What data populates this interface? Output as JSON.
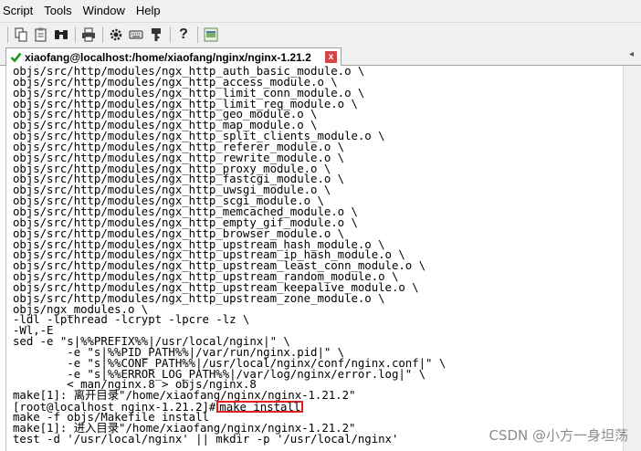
{
  "menubar": {
    "items": [
      "Script",
      "Tools",
      "Window",
      "Help"
    ]
  },
  "toolbar": {
    "icons": [
      "copy-icon",
      "paste-icon",
      "find-icon",
      "print-icon",
      "settings-icon",
      "keyboard-icon",
      "key-icon",
      "help-icon",
      "sftp-icon"
    ]
  },
  "tab": {
    "title": "xiaofang@localhost:/home/xiaofang/nginx/nginx-1.21.2",
    "close_label": "x",
    "scroll_arrow": "◂",
    "status_color": "#1a9a1a"
  },
  "terminal": {
    "lines": [
      "objs/src/http/modules/ngx_http_auth_basic_module.o \\",
      "objs/src/http/modules/ngx_http_access_module.o \\",
      "objs/src/http/modules/ngx_http_limit_conn_module.o \\",
      "objs/src/http/modules/ngx_http_limit_req_module.o \\",
      "objs/src/http/modules/ngx_http_geo_module.o \\",
      "objs/src/http/modules/ngx_http_map_module.o \\",
      "objs/src/http/modules/ngx_http_split_clients_module.o \\",
      "objs/src/http/modules/ngx_http_referer_module.o \\",
      "objs/src/http/modules/ngx_http_rewrite_module.o \\",
      "objs/src/http/modules/ngx_http_proxy_module.o \\",
      "objs/src/http/modules/ngx_http_fastcgi_module.o \\",
      "objs/src/http/modules/ngx_http_uwsgi_module.o \\",
      "objs/src/http/modules/ngx_http_scgi_module.o \\",
      "objs/src/http/modules/ngx_http_memcached_module.o \\",
      "objs/src/http/modules/ngx_http_empty_gif_module.o \\",
      "objs/src/http/modules/ngx_http_browser_module.o \\",
      "objs/src/http/modules/ngx_http_upstream_hash_module.o \\",
      "objs/src/http/modules/ngx_http_upstream_ip_hash_module.o \\",
      "objs/src/http/modules/ngx_http_upstream_least_conn_module.o \\",
      "objs/src/http/modules/ngx_http_upstream_random_module.o \\",
      "objs/src/http/modules/ngx_http_upstream_keepalive_module.o \\",
      "objs/src/http/modules/ngx_http_upstream_zone_module.o \\",
      "objs/ngx_modules.o \\",
      "-ldl -lpthread -lcrypt -lpcre -lz \\",
      "-Wl,-E",
      "sed -e \"s|%%PREFIX%%|/usr/local/nginx|\" \\",
      "        -e \"s|%%PID_PATH%%|/var/run/nginx.pid|\" \\",
      "        -e \"s|%%CONF_PATH%%|/usr/local/nginx/conf/nginx.conf|\" \\",
      "        -e \"s|%%ERROR_LOG_PATH%%|/var/log/nginx/error.log|\" \\",
      "        < man/nginx.8 > objs/nginx.8",
      "make[1]: 离开目录\"/home/xiaofang/nginx/nginx-1.21.2\""
    ],
    "prompt": "[root@localhost nginx-1.21.2]#",
    "command": "make install",
    "after_lines": [
      "make -f objs/Makefile install",
      "make[1]: 进入目录\"/home/xiaofang/nginx/nginx-1.21.2\"",
      "test -d '/usr/local/nginx' || mkdir -p '/usr/local/nginx'"
    ],
    "highlight_color": "#e02020"
  },
  "watermark": "CSDN @小方一身坦荡"
}
